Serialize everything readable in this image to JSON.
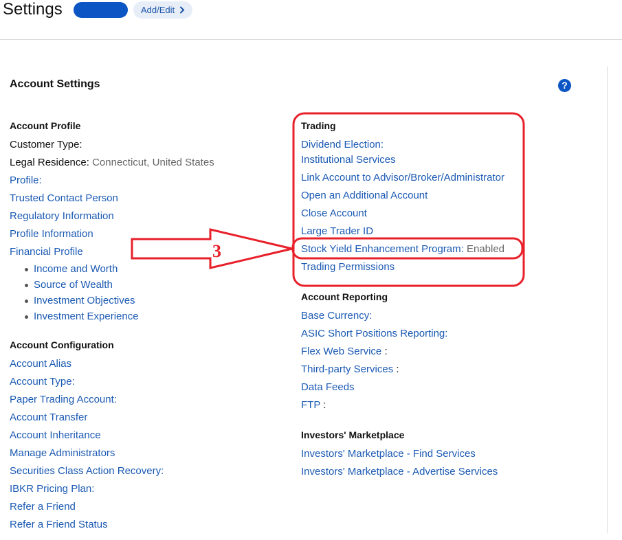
{
  "header": {
    "title": "Settings",
    "add_edit_label": "Add/Edit"
  },
  "page_title": "Account Settings",
  "account_profile": {
    "heading": "Account Profile",
    "customer_type_label": "Customer Type:",
    "legal_residence_label": "Legal Residence:",
    "legal_residence_value": "Connecticut, United States",
    "profile": "Profile:",
    "trusted_contact": "Trusted Contact Person",
    "regulatory_info": "Regulatory Information",
    "profile_info": "Profile Information",
    "financial_profile": "Financial Profile",
    "financial_sub": [
      "Income and Worth",
      "Source of Wealth",
      "Investment Objectives",
      "Investment Experience"
    ]
  },
  "account_configuration": {
    "heading": "Account Configuration",
    "items": [
      "Account Alias",
      "Account Type:",
      "Paper Trading Account:",
      "Account Transfer",
      "Account Inheritance",
      "Manage Administrators",
      "Securities Class Action Recovery:",
      "IBKR Pricing Plan:",
      "Refer a Friend",
      "Refer a Friend Status"
    ]
  },
  "trading": {
    "heading": "Trading",
    "dividend_election": "Dividend Election:",
    "institutional_services": "Institutional Services",
    "link_account": "Link Account to Advisor/Broker/Administrator",
    "open_additional": "Open an Additional Account",
    "close_account": "Close Account",
    "large_trader": "Large Trader ID",
    "syep": "Stock Yield Enhancement Program:",
    "syep_status": "Enabled",
    "permissions": "Trading Permissions"
  },
  "account_reporting": {
    "heading": "Account Reporting",
    "base_currency": "Base Currency:",
    "asic": "ASIC Short Positions Reporting:",
    "flex": "Flex Web Service",
    "third_party": "Third-party Services",
    "colon": ":",
    "data_feeds": "Data Feeds",
    "ftp": "FTP",
    "ftp_suffix": " :"
  },
  "investors_marketplace": {
    "heading": "Investors' Marketplace",
    "find": "Investors' Marketplace - Find Services",
    "advertise": "Investors' Marketplace - Advertise Services"
  },
  "annotation": {
    "number": "3",
    "color": "#e8202a"
  },
  "colors": {
    "link": "#1b5ab3",
    "brand": "#0b55c4"
  }
}
